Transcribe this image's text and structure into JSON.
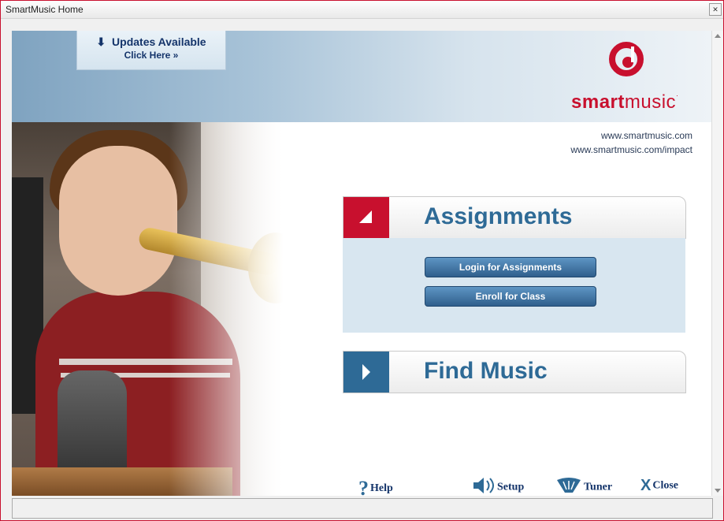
{
  "window": {
    "title": "SmartMusic Home"
  },
  "updates": {
    "line1": "Updates Available",
    "line2": "Click Here »"
  },
  "brand": {
    "smart": "smart",
    "music": "music"
  },
  "links": [
    "www.smartmusic.com",
    "www.smartmusic.com/impact"
  ],
  "assignments": {
    "title": "Assignments",
    "buttons": [
      "Login for Assignments",
      "Enroll for Class"
    ]
  },
  "find_music": {
    "title": "Find Music"
  },
  "bottom_bar": {
    "help": "Help",
    "setup": "Setup",
    "tuner": "Tuner",
    "close": "Close"
  },
  "colors": {
    "accent_red": "#c8102e",
    "accent_blue": "#2e6a96",
    "navy": "#14346a"
  },
  "icons": [
    "download-arrow-icon",
    "question-mark-icon",
    "speaker-icon",
    "tuner-icon",
    "close-x-icon",
    "smartmusic-logo-icon"
  ]
}
